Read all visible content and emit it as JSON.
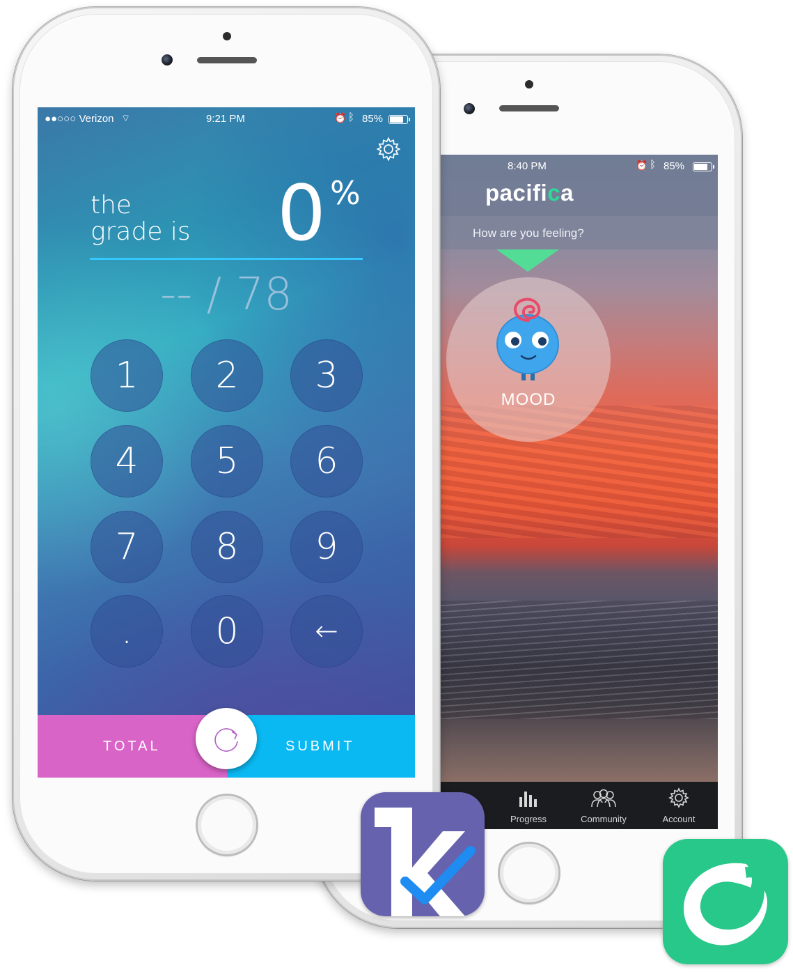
{
  "back_phone": {
    "status": {
      "time": "8:40 PM",
      "battery": "85%",
      "battery_level": 0.85
    },
    "app_name_prefix": "pacifi",
    "app_name_c": "c",
    "app_name_suffix": "a",
    "question": "How are you feeling?",
    "mood_label": "MOOD",
    "tabs": [
      {
        "label": "Progress",
        "icon": "bar-chart-icon"
      },
      {
        "label": "Community",
        "icon": "people-icon"
      },
      {
        "label": "Account",
        "icon": "gear-icon"
      }
    ],
    "colors": {
      "pointer": "#53dc95",
      "logo_accent": "#2ed89a"
    }
  },
  "front_phone": {
    "status": {
      "carrier": "●●○○○ Verizon",
      "time": "9:21 PM",
      "battery": "85%",
      "battery_level": 0.85
    },
    "grade_label_line1": "the",
    "grade_label_line2": "grade is",
    "grade_value": "0",
    "grade_unit": "%",
    "score": "-- / 78",
    "keys": [
      "1",
      "2",
      "3",
      "4",
      "5",
      "6",
      "7",
      "8",
      "9",
      ".",
      "0",
      "←"
    ],
    "total_label": "TOTAL",
    "submit_label": "SUBMIT",
    "colors": {
      "total": "#d964c8",
      "submit": "#0ab8f2",
      "underline": "#35c8ff"
    }
  },
  "icons": [
    {
      "name": "grade-app-icon",
      "color": "#6762ad"
    },
    {
      "name": "pacifica-app-icon",
      "color": "#28c88a"
    }
  ]
}
